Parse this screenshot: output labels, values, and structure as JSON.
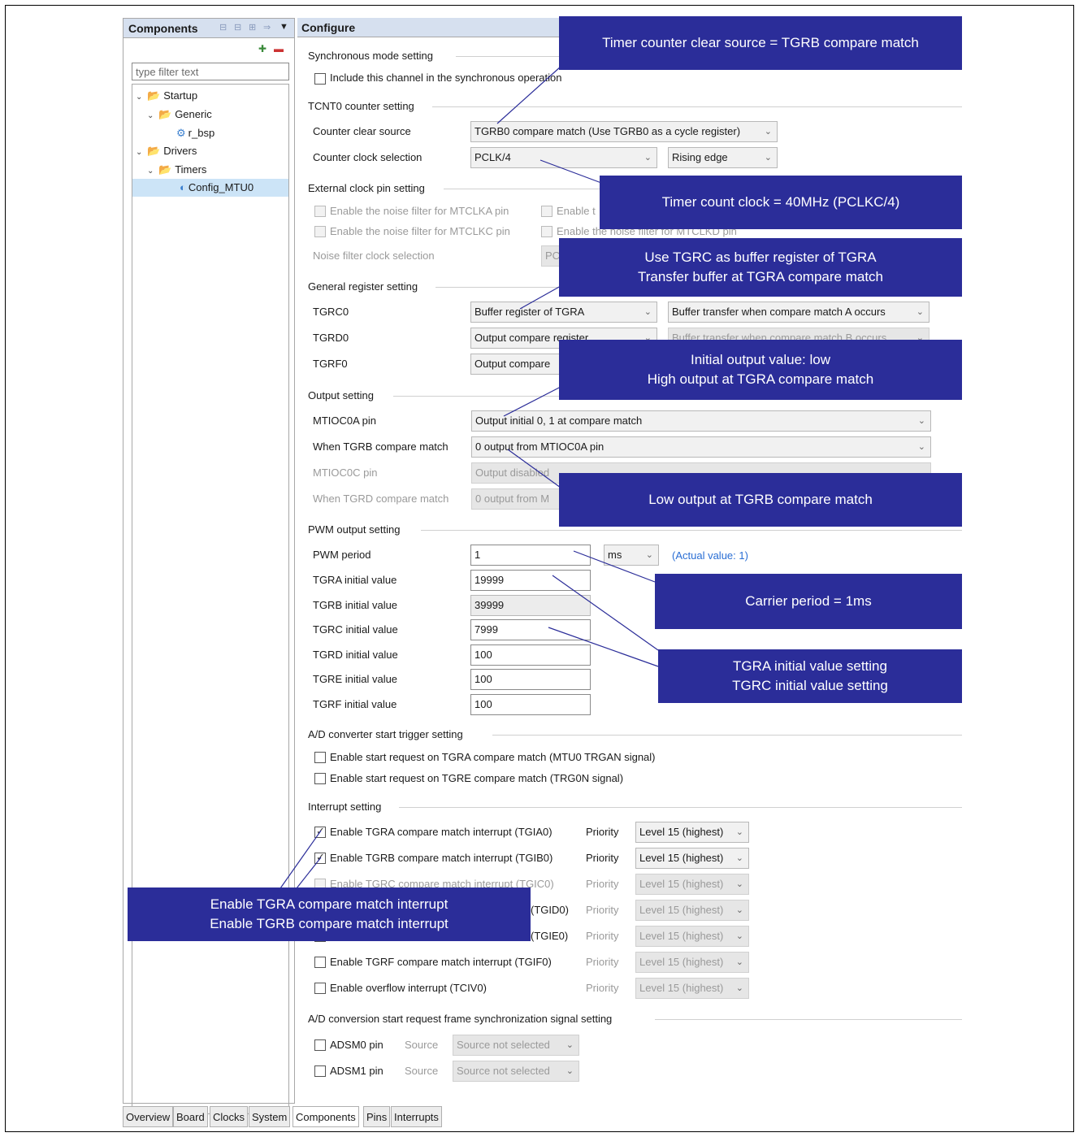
{
  "left_panel": {
    "title": "Components",
    "filter_placeholder": "type filter text",
    "tree": [
      {
        "label": "Startup"
      },
      {
        "label": "Generic"
      },
      {
        "label": "r_bsp"
      },
      {
        "label": "Drivers"
      },
      {
        "label": "Timers"
      },
      {
        "label": "Config_MTU0"
      }
    ]
  },
  "right_panel": {
    "title": "Configure",
    "sync": {
      "title": "Synchronous mode setting",
      "checkbox": "Include this channel in the synchronous operation"
    },
    "tcnt": {
      "title": "TCNT0 counter setting",
      "clear_label": "Counter clear source",
      "clear_value": "TGRB0 compare match (Use TGRB0 as a cycle register)",
      "clock_label": "Counter clock selection",
      "clock_value": "PCLK/4",
      "edge_value": "Rising edge"
    },
    "extclk": {
      "title": "External clock pin setting",
      "cb1": "Enable the noise filter for MTCLKA pin",
      "cb2": "Enable t",
      "cb3": "Enable the noise filter for MTCLKC pin",
      "cb4": "Enable the noise filter for MTCLKD pin",
      "noise_label": "Noise filter clock selection",
      "noise_value": "PC"
    },
    "general": {
      "title": "General register setting",
      "rows": [
        {
          "label": "TGRC0",
          "v1": "Buffer register of TGRA",
          "v2": "Buffer transfer when compare match A occurs"
        },
        {
          "label": "TGRD0",
          "v1": "Output compare register",
          "v2": "Buffer transfer when compare match B occurs"
        },
        {
          "label": "TGRF0",
          "v1": "Output compare",
          "v2": ""
        }
      ]
    },
    "output": {
      "title": "Output setting",
      "rows": [
        {
          "label": "MTIOC0A pin",
          "value": "Output initial 0, 1 at compare match"
        },
        {
          "label": "When TGRB compare match",
          "value": "0 output from MTIOC0A pin"
        },
        {
          "label": "MTIOC0C pin",
          "value": "Output disabled"
        },
        {
          "label": "When TGRD compare match",
          "value": "0 output from M"
        }
      ]
    },
    "pwm": {
      "title": "PWM output setting",
      "period_label": "PWM period",
      "period_value": "1",
      "unit": "ms",
      "actual": "(Actual value: 1)",
      "rows": [
        {
          "label": "TGRA initial value",
          "value": "19999"
        },
        {
          "label": "TGRB initial value",
          "value": "39999"
        },
        {
          "label": "TGRC initial value",
          "value": "7999"
        },
        {
          "label": "TGRD initial value",
          "value": "100"
        },
        {
          "label": "TGRE initial value",
          "value": "100"
        },
        {
          "label": "TGRF initial value",
          "value": "100"
        }
      ]
    },
    "ad": {
      "title": "A/D converter start trigger setting",
      "cb1": "Enable start request on TGRA compare match (MTU0 TRGAN signal)",
      "cb2": "Enable start request on TGRE compare match (TRG0N signal)"
    },
    "interrupt": {
      "title": "Interrupt setting",
      "priority_label": "Priority",
      "level": "Level 15 (highest)",
      "rows": [
        {
          "label": "Enable TGRA compare match interrupt (TGIA0)"
        },
        {
          "label": "Enable TGRB compare match interrupt (TGIB0)"
        },
        {
          "label": "Enable TGRC compare match interrupt (TGIC0)"
        },
        {
          "label": "(TGID0)"
        },
        {
          "label": "(TGIE0)"
        },
        {
          "label": "Enable TGRF compare match interrupt (TGIF0)"
        },
        {
          "label": "Enable overflow interrupt (TCIV0)"
        }
      ]
    },
    "adsm": {
      "title": "A/D conversion start request frame synchronization signal setting",
      "source_label": "Source",
      "source_value": "Source not selected",
      "rows": [
        {
          "label": "ADSM0 pin"
        },
        {
          "label": "ADSM1 pin"
        }
      ]
    }
  },
  "callouts": {
    "c1": "Timer counter clear source = TGRB compare match",
    "c2": "Timer count clock = 40MHz (PCLKC/4)",
    "c3a": "Use TGRC as buffer register of TGRA",
    "c3b": "Transfer buffer at TGRA compare match",
    "c4a": "Initial output value: low",
    "c4b": "High output at TGRA compare match",
    "c5": "Low output at TGRB compare match",
    "c6": "Carrier period = 1ms",
    "c7a": "TGRA initial value setting",
    "c7b": "TGRC initial value setting",
    "c8a": "Enable TGRA compare match interrupt",
    "c8b": "Enable TGRB compare match interrupt"
  },
  "bottom_tabs": [
    "Overview",
    "Board",
    "Clocks",
    "System",
    "Components",
    "Pins",
    "Interrupts"
  ],
  "colors": {
    "callout_bg": "#2b2d99",
    "header_bg": "#d6e0ef",
    "selected": "#cce4f7",
    "link": "#2a6ed4"
  }
}
